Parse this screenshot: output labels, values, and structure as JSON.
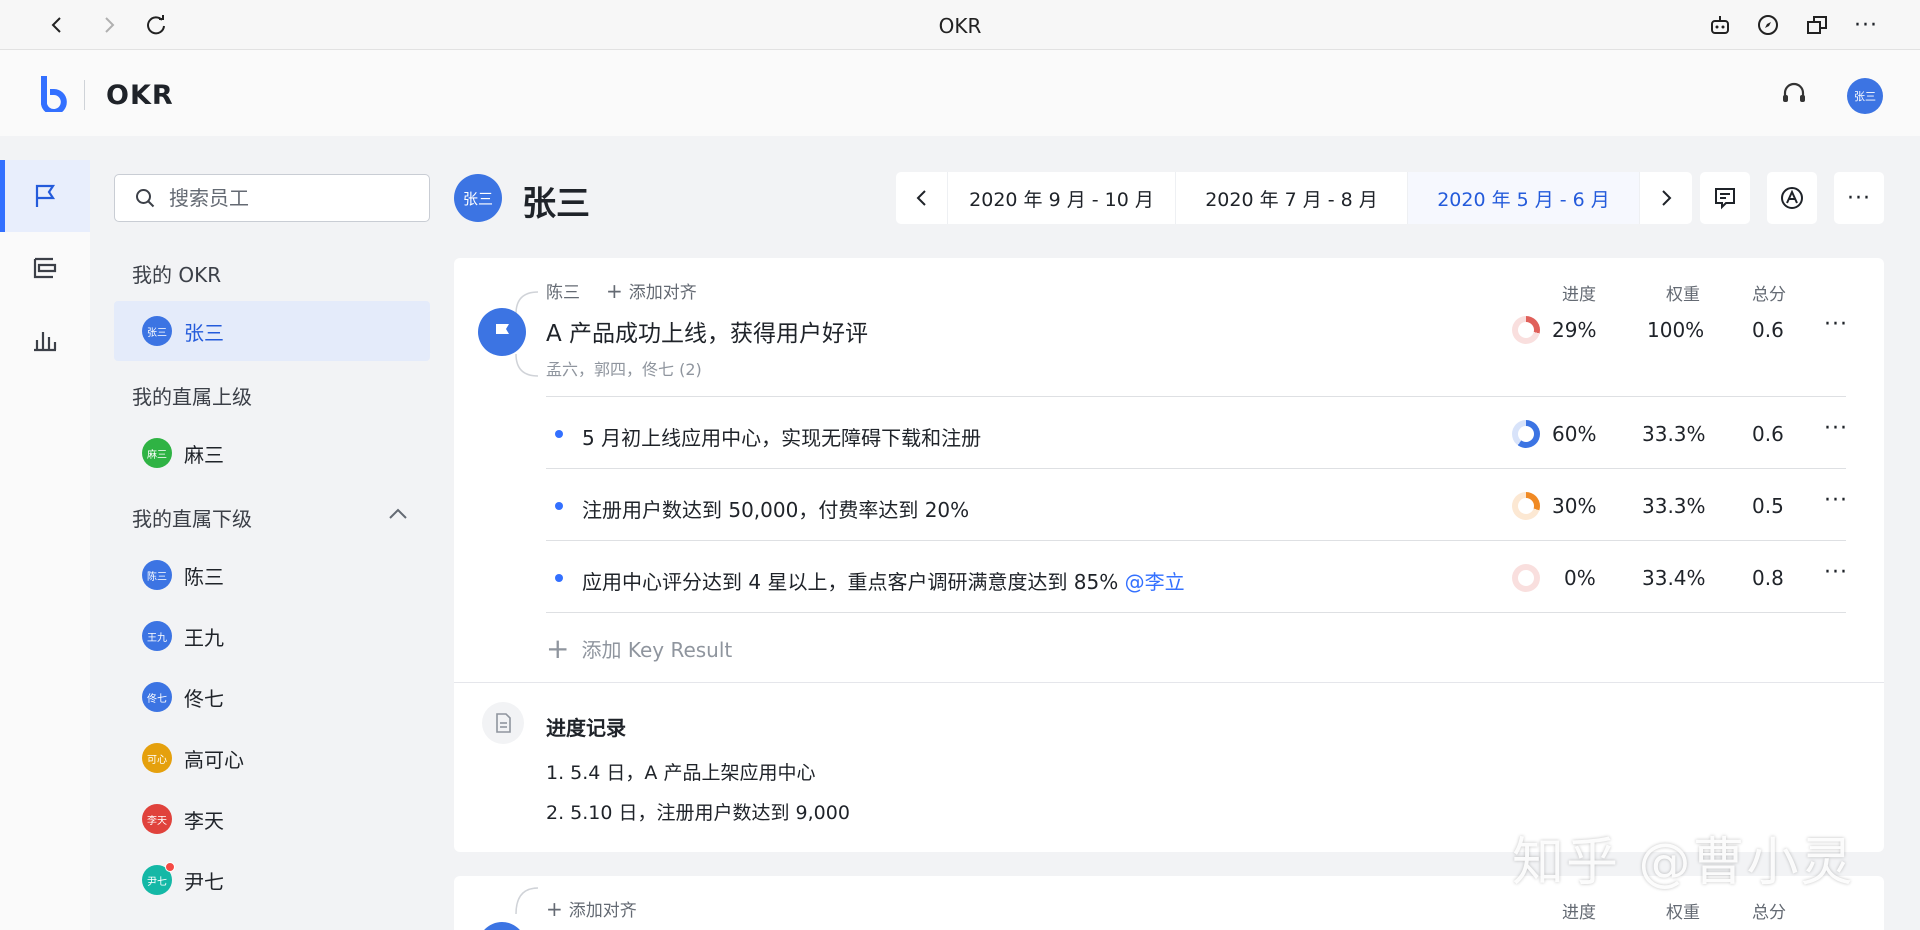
{
  "browser": {
    "title": "OKR"
  },
  "app": {
    "title": "OKR",
    "user_avatar": "张三"
  },
  "search": {
    "placeholder": "搜索员工"
  },
  "sidebar": {
    "my_okr_title": "我的 OKR",
    "my_okr": [
      {
        "avatar": "张三",
        "name": "张三",
        "color": "#3c74e3"
      }
    ],
    "superior_title": "我的直属上级",
    "superiors": [
      {
        "avatar": "麻三",
        "name": "麻三",
        "color": "#2fb344"
      }
    ],
    "subordinates_title": "我的直属下级",
    "subordinates": [
      {
        "avatar": "陈三",
        "name": "陈三",
        "color": "#3c74e3"
      },
      {
        "avatar": "王九",
        "name": "王九",
        "color": "#3c74e3"
      },
      {
        "avatar": "佟七",
        "name": "佟七",
        "color": "#3c74e3"
      },
      {
        "avatar": "可心",
        "name": "高可心",
        "color": "#e5a00d"
      },
      {
        "avatar": "李天",
        "name": "李天",
        "color": "#e0423c"
      },
      {
        "avatar": "尹七",
        "name": "尹七",
        "color": "#14b8a6"
      }
    ]
  },
  "main": {
    "user_avatar": "张三",
    "user_name": "张三",
    "periods": [
      "2020 年 9 月 - 10 月",
      "2020 年 7 月 - 8 月",
      "2020 年 5 月 - 6 月"
    ],
    "selected_period": "2020 年 5 月 - 6 月"
  },
  "objective": {
    "aligned_to": "陈三",
    "add_align": "添加对齐",
    "columns": {
      "progress": "进度",
      "weight": "权重",
      "score": "总分"
    },
    "title": "A 产品成功上线，获得用户好评",
    "progress": "29%",
    "progress_value": 0.29,
    "weight": "100%",
    "score": "0.6",
    "participants": "孟六，郭四，佟七 (2)",
    "ring_color": "#e0605a",
    "key_results": [
      {
        "text": "5 月初上线应用中心，实现无障碍下载和注册",
        "mention": "",
        "progress": "60%",
        "progress_value": 0.6,
        "weight": "33.3%",
        "score": "0.6",
        "ring_color": "#3c74e3"
      },
      {
        "text": "注册用户数达到 50,000，付费率达到 20%",
        "mention": "",
        "progress": "30%",
        "progress_value": 0.3,
        "weight": "33.3%",
        "score": "0.5",
        "ring_color": "#f08a24"
      },
      {
        "text": "应用中心评分达到 4 星以上，重点客户调研满意度达到 85% ",
        "mention": "@李立",
        "progress": "0%",
        "progress_value": 0,
        "weight": "33.4%",
        "score": "0.8",
        "ring_color": "#e0605a"
      }
    ],
    "add_kr": "添加 Key Result",
    "log_title": "进度记录",
    "log_items": [
      "1. 5.4 日，A 产品上架应用中心",
      "2. 5.10 日，注册用户数达到 9,000"
    ]
  },
  "objective2": {
    "add_align": "添加对齐",
    "columns": {
      "progress": "进度",
      "weight": "权重",
      "score": "总分"
    }
  },
  "watermark": "知乎 @曹小灵"
}
